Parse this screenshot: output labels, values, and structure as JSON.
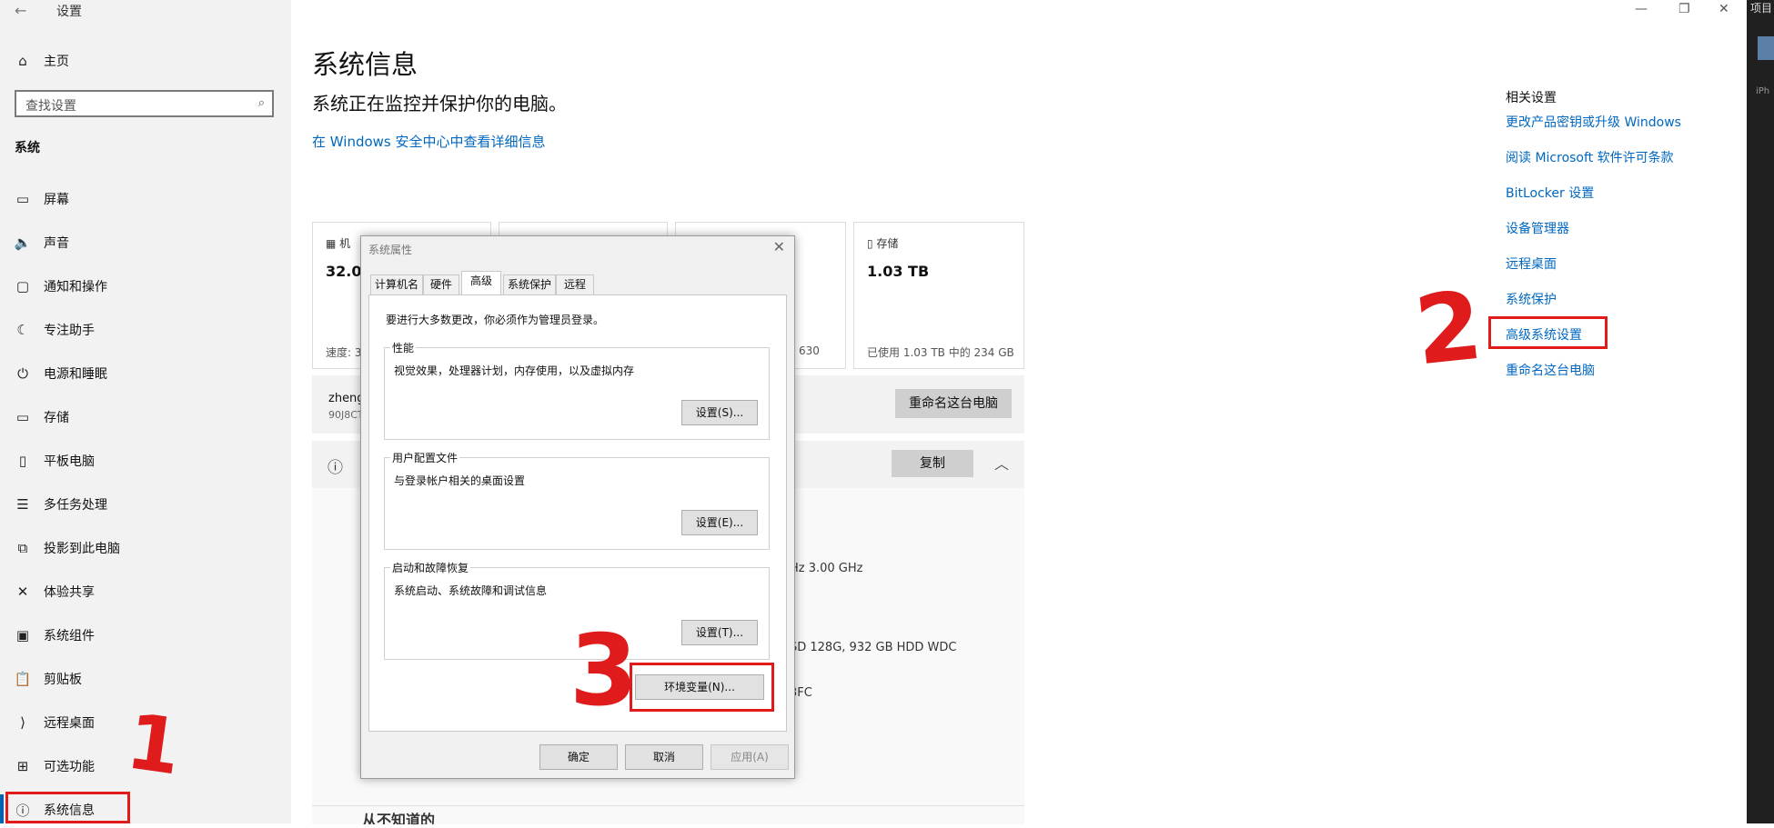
{
  "app": {
    "title": "设置",
    "back_icon": "back-arrow-icon"
  },
  "sidebar": {
    "home": "主页",
    "search_placeholder": "查找设置",
    "section": "系统",
    "items": [
      {
        "label": "屏幕",
        "icon": "display-icon"
      },
      {
        "label": "声音",
        "icon": "speaker-icon"
      },
      {
        "label": "通知和操作",
        "icon": "notification-icon"
      },
      {
        "label": "专注助手",
        "icon": "moon-icon"
      },
      {
        "label": "电源和睡眠",
        "icon": "power-icon"
      },
      {
        "label": "存储",
        "icon": "storage-icon"
      },
      {
        "label": "平板电脑",
        "icon": "tablet-icon"
      },
      {
        "label": "多任务处理",
        "icon": "multitask-icon"
      },
      {
        "label": "投影到此电脑",
        "icon": "project-icon"
      },
      {
        "label": "体验共享",
        "icon": "share-icon"
      },
      {
        "label": "系统组件",
        "icon": "components-icon"
      },
      {
        "label": "剪贴板",
        "icon": "clipboard-icon"
      },
      {
        "label": "远程桌面",
        "icon": "remote-icon"
      },
      {
        "label": "可选功能",
        "icon": "features-icon"
      },
      {
        "label": "系统信息",
        "icon": "info-icon"
      }
    ]
  },
  "main": {
    "title": "系统信息",
    "subtitle": "系统正在监控并保护你的电脑。",
    "security_link": "在 Windows 安全中心中查看详细信息",
    "card1_cap": "机",
    "card1_big": "32.0",
    "card1_foot": "速度: 3",
    "card3_foot": "630",
    "card4_cap": "存储",
    "card4_big": "1.03 TB",
    "card4_foot": "已使用 1.03 TB 中的 234 GB",
    "device_name": "zheng",
    "device_id": "90J8CT",
    "rename_button": "重命名这台电脑",
    "copy_button": "复制",
    "spec_cpu_tail": "Hz   3.00 GHz",
    "spec_disk_tail": "SD  128G,  932  GB  HDD  WDC",
    "spec_id_tail": "3FC",
    "bottom_text": "从不知道的"
  },
  "related": {
    "title": "相关设置",
    "links": [
      "更改产品密钥或升级 Windows",
      "阅读 Microsoft 软件许可条款",
      "BitLocker 设置",
      "设备管理器",
      "远程桌面",
      "系统保护",
      "高级系统设置",
      "重命名这台电脑"
    ]
  },
  "dialog": {
    "title": "系统属性",
    "tabs": [
      "计算机名",
      "硬件",
      "高级",
      "系统保护",
      "远程"
    ],
    "note": "要进行大多数更改，你必须作为管理员登录。",
    "groups": [
      {
        "title": "性能",
        "desc": "视觉效果，处理器计划，内存使用，以及虚拟内存",
        "button": "设置(S)..."
      },
      {
        "title": "用户配置文件",
        "desc": "与登录帐户相关的桌面设置",
        "button": "设置(E)..."
      },
      {
        "title": "启动和故障恢复",
        "desc": "系统启动、系统故障和调试信息",
        "button": "设置(T)..."
      }
    ],
    "env_button": "环境变量(N)...",
    "ok": "确定",
    "cancel": "取消",
    "apply": "应用(A)"
  },
  "annotations": {
    "mark1": "1",
    "mark2": "2",
    "mark3": "3"
  },
  "edge": {
    "top_text": "项目",
    "bottom_text": "iPh"
  },
  "colors": {
    "accent": "#0067c0",
    "annotation": "#e01b1b",
    "sidebar_bg": "#f2f2f2"
  }
}
